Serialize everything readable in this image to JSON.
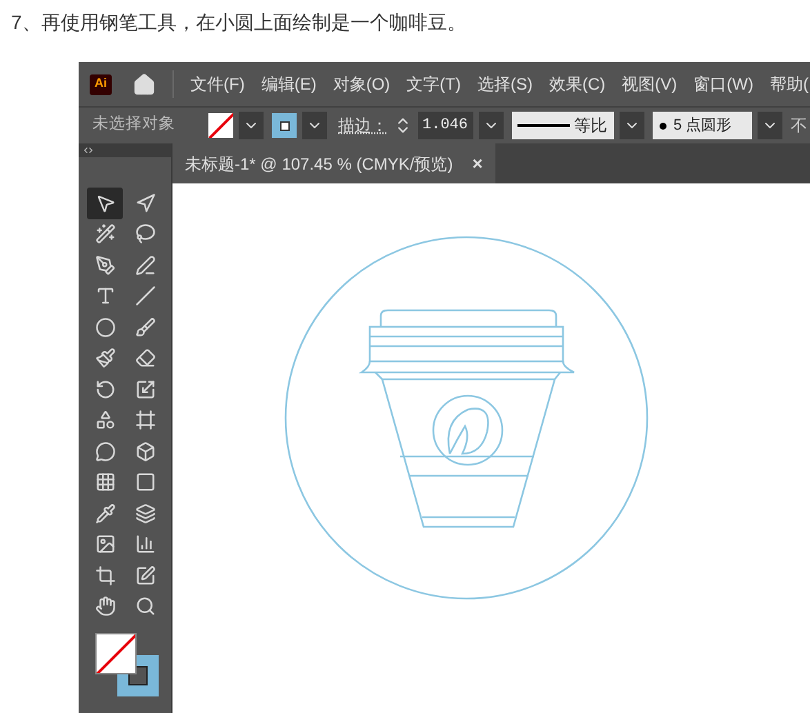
{
  "heading": "7、再使用钢笔工具，在小圆上面绘制是一个咖啡豆。",
  "app": {
    "logo": "Ai",
    "menu": [
      "文件(F)",
      "编辑(E)",
      "对象(O)",
      "文字(T)",
      "选择(S)",
      "效果(C)",
      "视图(V)",
      "窗口(W)",
      "帮助("
    ],
    "control_bar": {
      "selection": "未选择对象",
      "stroke_label": "描边：",
      "stroke_weight": "1.046",
      "profile": "等比",
      "brush": "5 点圆形",
      "cut_label": "不"
    },
    "document_tab": {
      "title": "未标题-1* @ 107.45 % (CMYK/预览)",
      "close": "×"
    },
    "tools": [
      {
        "selected": true
      },
      {
        "selected": false
      },
      {
        "selected": false
      },
      {
        "selected": false
      },
      {
        "selected": false
      },
      {
        "selected": false
      },
      {
        "selected": false
      },
      {
        "selected": false
      },
      {
        "selected": false
      },
      {
        "selected": false
      },
      {
        "selected": false
      },
      {
        "selected": false
      },
      {
        "selected": false
      },
      {
        "selected": false
      },
      {
        "selected": false
      },
      {
        "selected": false
      },
      {
        "selected": false
      },
      {
        "selected": false
      },
      {
        "selected": false
      },
      {
        "selected": false
      },
      {
        "selected": false
      },
      {
        "selected": false
      },
      {
        "selected": false
      },
      {
        "selected": false
      },
      {
        "selected": false
      },
      {
        "selected": false
      },
      {
        "selected": false
      },
      {
        "selected": false
      }
    ]
  }
}
